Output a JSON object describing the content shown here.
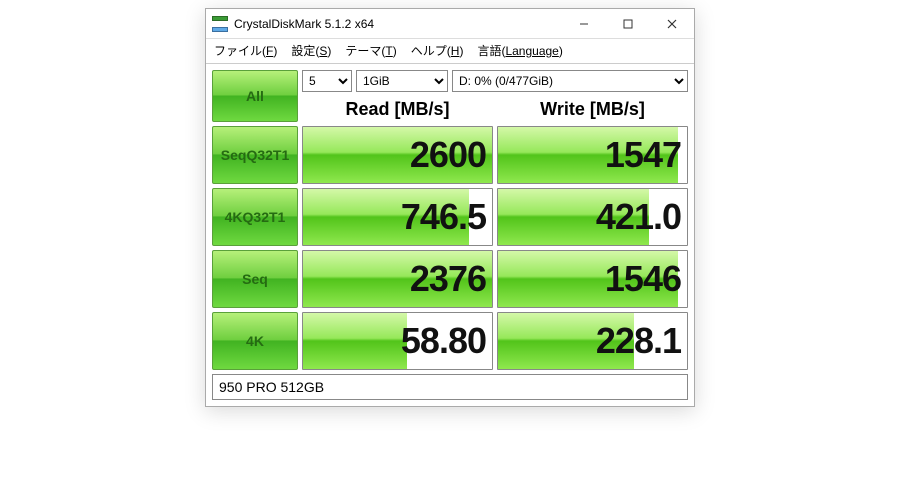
{
  "titlebar": {
    "title": "CrystalDiskMark 5.1.2 x64"
  },
  "menu": {
    "file": {
      "label": "ファイル",
      "mnemonic": "F"
    },
    "settings": {
      "label": "設定",
      "mnemonic": "S"
    },
    "theme": {
      "label": "テーマ",
      "mnemonic": "T"
    },
    "help": {
      "label": "ヘルプ",
      "mnemonic": "H"
    },
    "lang": {
      "label": "言語",
      "mnemonic": "Language"
    }
  },
  "controls": {
    "all_label": "All",
    "count_value": "5",
    "size_value": "1GiB",
    "drive_value": "D: 0% (0/477GiB)"
  },
  "headers": {
    "read": "Read [MB/s]",
    "write": "Write [MB/s]"
  },
  "rows": [
    {
      "label_line1": "Seq",
      "label_line2": "Q32T1",
      "read": "2600",
      "read_fill": 100,
      "write": "1547",
      "write_fill": 95
    },
    {
      "label_line1": "4K",
      "label_line2": "Q32T1",
      "read": "746.5",
      "read_fill": 88,
      "write": "421.0",
      "write_fill": 80
    },
    {
      "label_line1": "Seq",
      "label_line2": "",
      "read": "2376",
      "read_fill": 100,
      "write": "1546",
      "write_fill": 95
    },
    {
      "label_line1": "4K",
      "label_line2": "",
      "read": "58.80",
      "read_fill": 55,
      "write": "228.1",
      "write_fill": 72
    }
  ],
  "footer": {
    "value": "950 PRO 512GB"
  }
}
